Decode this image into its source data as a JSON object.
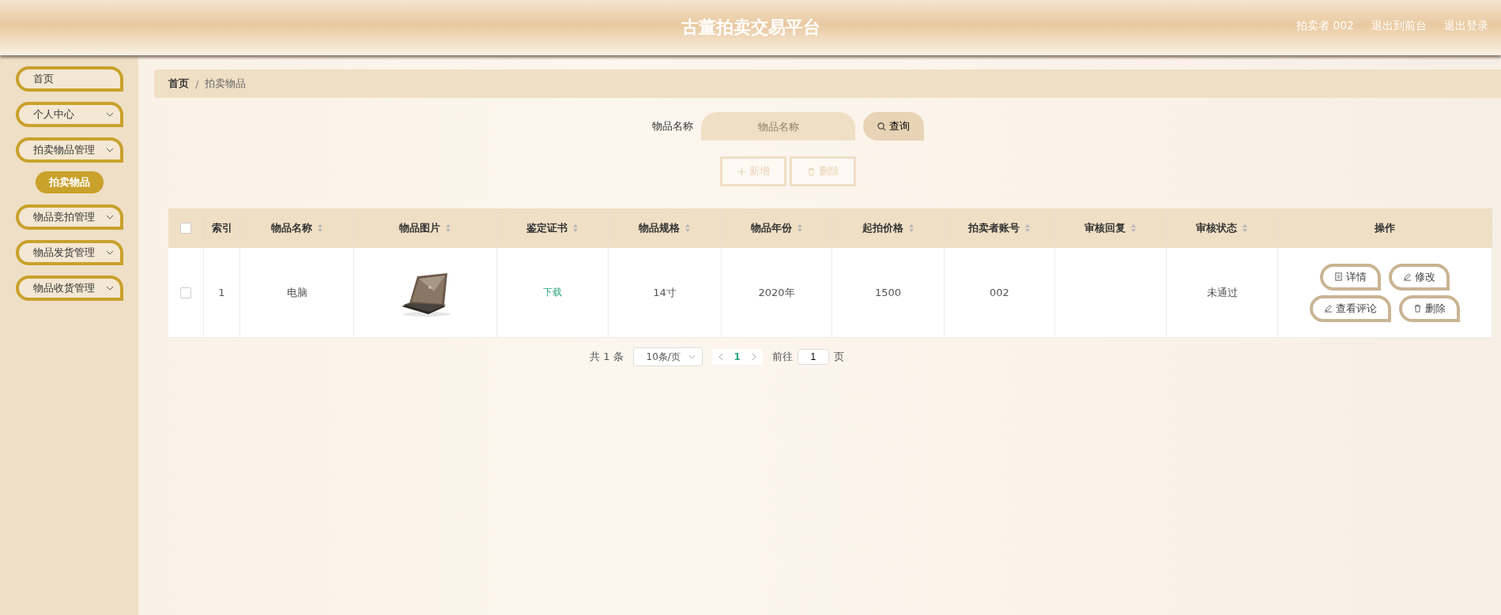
{
  "header": {
    "title": "古董拍卖交易平台",
    "links": [
      "拍卖者 002",
      "退出到前台",
      "退出登录"
    ]
  },
  "sidebar": {
    "items": [
      {
        "label": "首页",
        "kind": "link"
      },
      {
        "label": "个人中心",
        "kind": "group"
      },
      {
        "label": "拍卖物品管理",
        "kind": "group",
        "children": [
          {
            "label": "拍卖物品",
            "selected": true
          }
        ]
      },
      {
        "label": "物品竞拍管理",
        "kind": "group"
      },
      {
        "label": "物品发货管理",
        "kind": "group"
      },
      {
        "label": "物品收货管理",
        "kind": "group"
      }
    ]
  },
  "breadcrumb": [
    "首页",
    "拍卖物品"
  ],
  "breadcrumb_separator": "/",
  "search": {
    "label": "物品名称",
    "placeholder": "物品名称",
    "button": "查询"
  },
  "actions": [
    {
      "label": "新增",
      "kind": "add"
    },
    {
      "label": "删除",
      "kind": "delete"
    }
  ],
  "table": {
    "select_all_checked": false,
    "columns": [
      {
        "label": "索引",
        "sortable": false
      },
      {
        "label": "物品名称",
        "sortable": true
      },
      {
        "label": "物品图片",
        "sortable": true
      },
      {
        "label": "鉴定证书",
        "sortable": true
      },
      {
        "label": "物品规格",
        "sortable": true
      },
      {
        "label": "物品年份",
        "sortable": true
      },
      {
        "label": "起拍价格",
        "sortable": true
      },
      {
        "label": "拍卖者账号",
        "sortable": true
      },
      {
        "label": "审核回复",
        "sortable": true
      },
      {
        "label": "审核状态",
        "sortable": true
      },
      {
        "label": "操作",
        "sortable": false
      }
    ],
    "rows": [
      {
        "checked": false,
        "index": "1",
        "name": "电脑",
        "certificate": "下载",
        "spec": "14寸",
        "year": "2020年",
        "price": "1500",
        "account": "002",
        "status": "未通过",
        "buttons": [
          {
            "label": "详情",
            "kind": "detail"
          },
          {
            "label": "修改",
            "kind": "edit"
          },
          {
            "label": "查看评论",
            "kind": "comment"
          },
          {
            "label": "删除",
            "kind": "delete"
          }
        ]
      }
    ]
  },
  "pagination": {
    "total": "共 1 条",
    "page_size": "10条/页",
    "pages": [
      {
        "label": "1",
        "selected": true
      }
    ],
    "goto_label": "前往",
    "goto_value": "1",
    "goto_suffix": "页"
  }
}
